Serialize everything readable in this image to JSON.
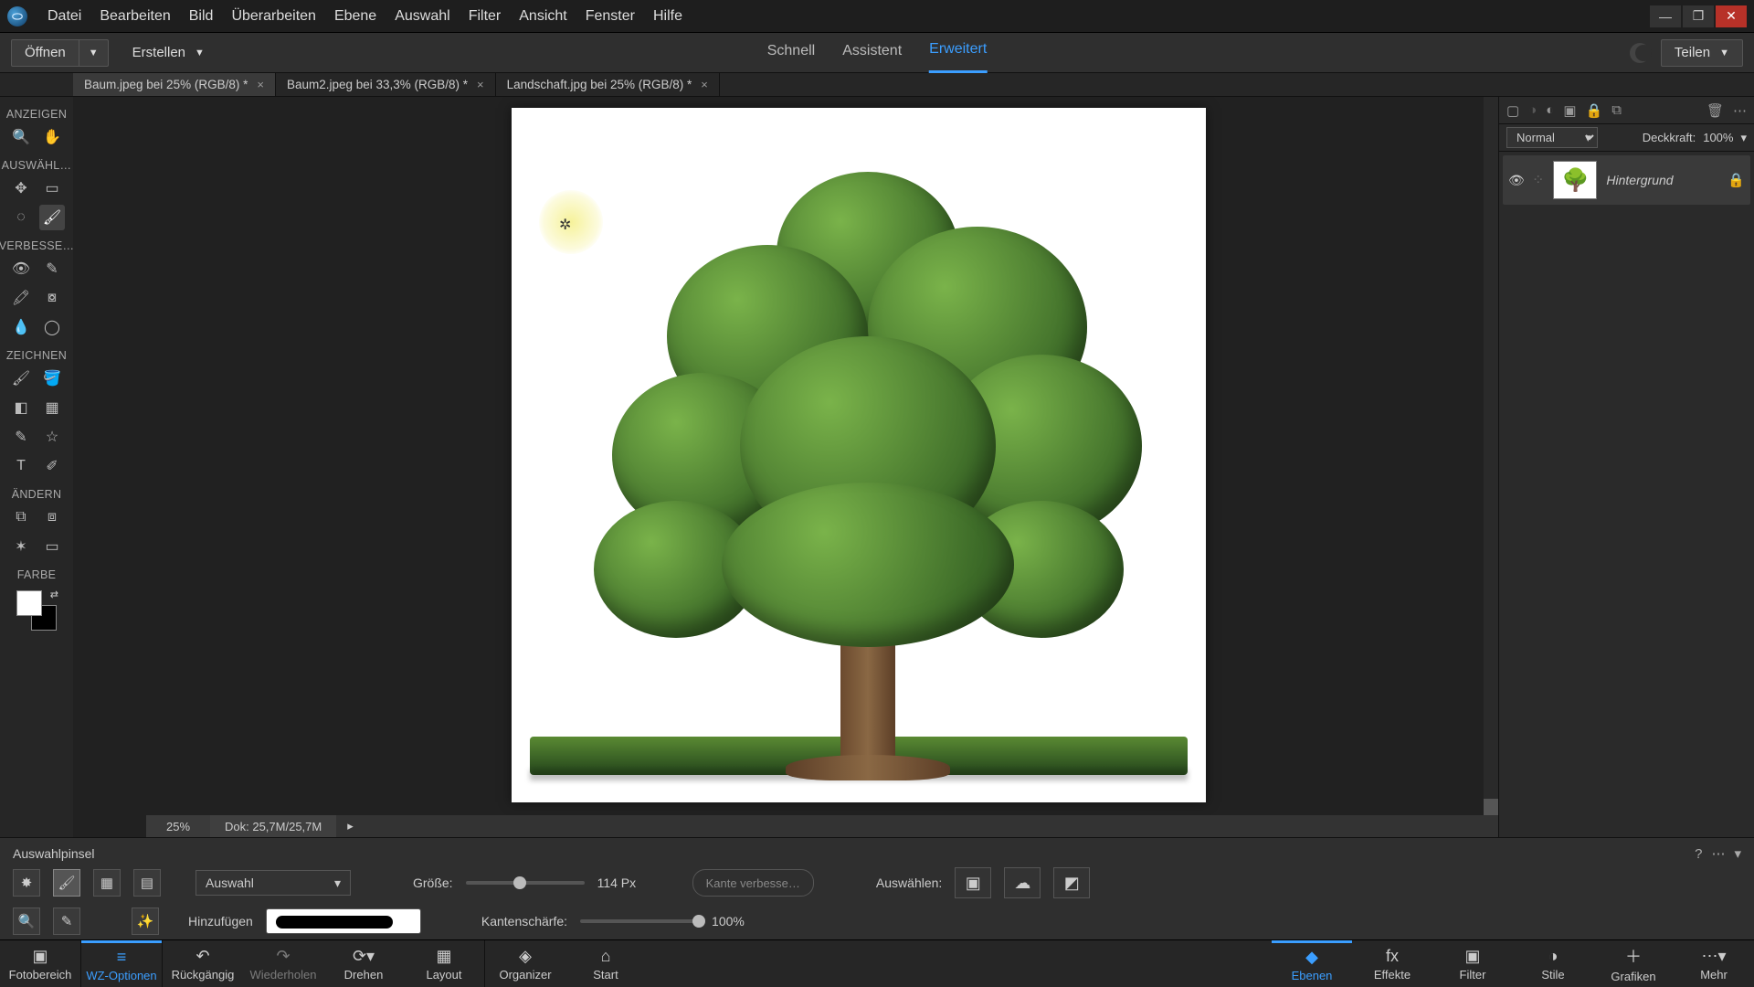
{
  "menubar": [
    "Datei",
    "Bearbeiten",
    "Bild",
    "Überarbeiten",
    "Ebene",
    "Auswahl",
    "Filter",
    "Ansicht",
    "Fenster",
    "Hilfe"
  ],
  "topbar": {
    "open": "Öffnen",
    "create": "Erstellen",
    "modes": {
      "quick": "Schnell",
      "guided": "Assistent",
      "expert": "Erweitert"
    },
    "share": "Teilen"
  },
  "documents": [
    {
      "label": "Baum.jpeg bei 25% (RGB/8) *",
      "active": true
    },
    {
      "label": "Baum2.jpeg bei 33,3% (RGB/8) *",
      "active": false
    },
    {
      "label": "Landschaft.jpg bei 25% (RGB/8) *",
      "active": false
    }
  ],
  "toolbar_sections": {
    "view": "ANZEIGEN",
    "select": "AUSWÄHL…",
    "enhance": "VERBESSE…",
    "draw": "ZEICHNEN",
    "modify": "ÄNDERN",
    "color": "FARBE"
  },
  "status": {
    "zoom": "25%",
    "doc": "Dok: 25,7M/25,7M"
  },
  "layers": {
    "blend_mode": "Normal",
    "opacity_label": "Deckkraft:",
    "opacity_value": "100%",
    "items": [
      {
        "name": "Hintergrund",
        "locked": true
      }
    ]
  },
  "options": {
    "tool_name": "Auswahlpinsel",
    "mode_dropdown": "Auswahl",
    "add_label": "Hinzufügen",
    "size_label": "Größe:",
    "size_value": "114 Px",
    "size_slider_pct": 40,
    "hardness_label": "Kantenschärfe:",
    "hardness_value": "100%",
    "hardness_slider_pct": 100,
    "refine_edge": "Kante verbesse…",
    "select_label": "Auswählen:"
  },
  "taskbar_left": [
    {
      "label": "Fotobereich"
    },
    {
      "label": "WZ-Optionen",
      "active": true
    },
    {
      "label": "Rückgängig"
    },
    {
      "label": "Wiederholen"
    },
    {
      "label": "Drehen"
    },
    {
      "label": "Layout"
    },
    {
      "label": "Organizer"
    },
    {
      "label": "Start"
    }
  ],
  "taskbar_right": [
    {
      "label": "Ebenen",
      "active": true
    },
    {
      "label": "Effekte"
    },
    {
      "label": "Filter"
    },
    {
      "label": "Stile"
    },
    {
      "label": "Grafiken"
    },
    {
      "label": "Mehr"
    }
  ]
}
